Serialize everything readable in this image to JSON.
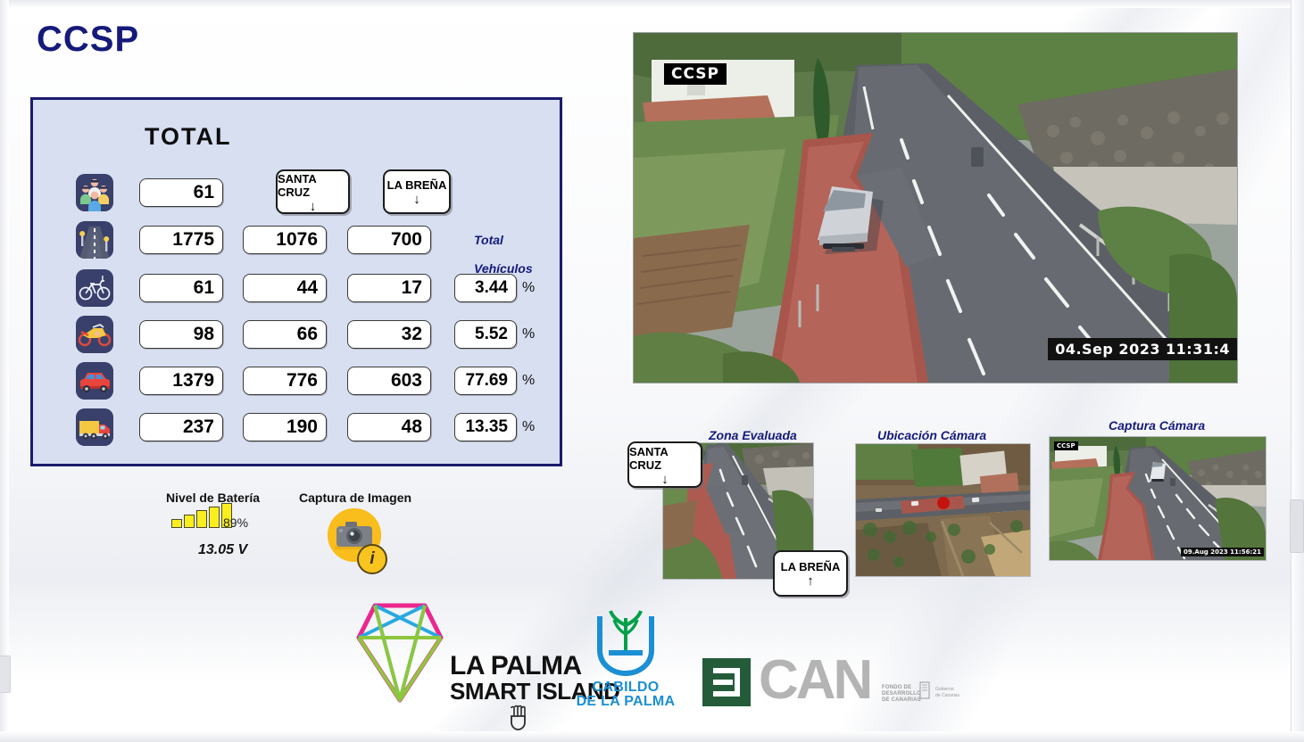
{
  "app": {
    "title": "CCSP"
  },
  "panel": {
    "title": "TOTAL",
    "col_headers": {
      "santa_cruz": "SANTA CRUZ",
      "la_brena": "LA BREÑA",
      "arrow_down": "↓",
      "arrow_up": "↑"
    },
    "total_vehicles_label": "Total Vehículos",
    "percent_symbol": "%",
    "rows": [
      {
        "icon": "pedestrians-icon",
        "total": "61",
        "santa_cruz": "",
        "la_brena": "",
        "percent": ""
      },
      {
        "icon": "road-icon",
        "total": "1775",
        "santa_cruz": "1076",
        "la_brena": "700",
        "percent": ""
      },
      {
        "icon": "bicycle-icon",
        "total": "61",
        "santa_cruz": "44",
        "la_brena": "17",
        "percent": "3.44"
      },
      {
        "icon": "motorcycle-icon",
        "total": "98",
        "santa_cruz": "66",
        "la_brena": "32",
        "percent": "5.52"
      },
      {
        "icon": "car-icon",
        "total": "1379",
        "santa_cruz": "776",
        "la_brena": "603",
        "percent": "77.69"
      },
      {
        "icon": "truck-icon",
        "total": "237",
        "santa_cruz": "190",
        "la_brena": "48",
        "percent": "13.35"
      }
    ]
  },
  "battery": {
    "label": "Nivel de Batería",
    "percent": "89%",
    "voltage": "13.05 V"
  },
  "capture": {
    "label": "Captura de Imagen",
    "info_glyph": "i"
  },
  "video": {
    "watermark": "CCSP",
    "timestamp": "04.Sep 2023   11:31:4"
  },
  "thumbnails": [
    {
      "caption": "Zona Evaluada",
      "overlay_top": "SANTA CRUZ",
      "overlay_top_arrow": "↓",
      "overlay_bottom": "LA BREÑA",
      "overlay_bottom_arrow": "↑"
    },
    {
      "caption": "Ubicación Cámara"
    },
    {
      "caption": "Captura Cámara",
      "watermark": "CCSP",
      "timestamp": "09.Aug 2023  11:56:21"
    }
  ],
  "footer": {
    "smart_island_line1": "LA PALMA",
    "smart_island_line2": "SMART ISLAND",
    "cabildo_line1": "CABILDO",
    "cabildo_line2": "DE LA PALMA",
    "can_text": "CAN",
    "can_sub_line1": "FONDO DE",
    "can_sub_line2": "DESARROLLO",
    "can_sub_line3": "DE CANARIAS",
    "can_gov_line1": "Gobierno",
    "can_gov_line2": "de Canarias"
  },
  "colors": {
    "navy": "#151a7b",
    "panel_bg": "#d7dff1",
    "panel_border": "#1b1b6e",
    "battery_yellow": "#fbee1e",
    "capture_orange": "#f9bd1c"
  }
}
